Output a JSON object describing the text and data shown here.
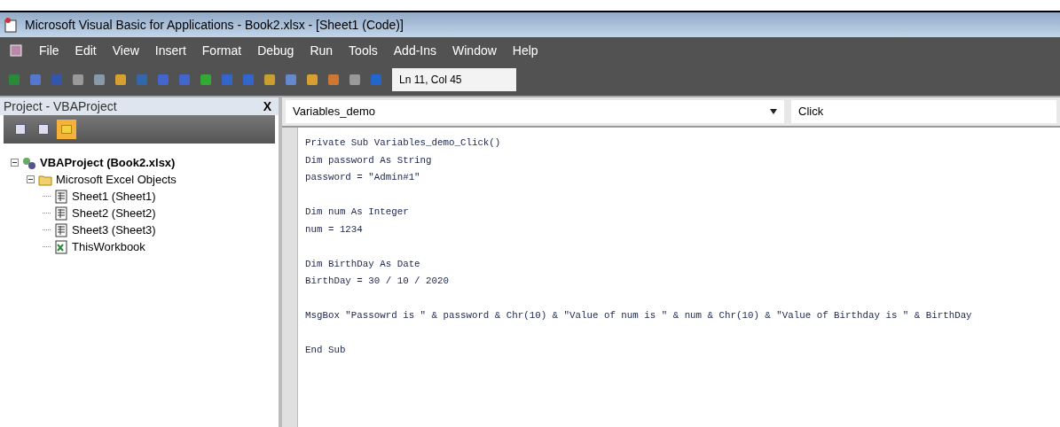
{
  "window": {
    "title": "Microsoft Visual Basic for Applications - Book2.xlsx - [Sheet1 (Code)]"
  },
  "menu": [
    "File",
    "Edit",
    "View",
    "Insert",
    "Format",
    "Debug",
    "Run",
    "Tools",
    "Add-Ins",
    "Window",
    "Help"
  ],
  "toolbar": {
    "position": "Ln 11, Col 45"
  },
  "project_pane": {
    "title": "Project - VBAProject",
    "close": "X",
    "view_buttons": [
      {
        "selected": false
      },
      {
        "selected": false
      },
      {
        "selected": true
      }
    ],
    "tree": [
      {
        "label": "VBAProject (Book2.xlsx)",
        "kind": "project",
        "expanded": true,
        "children": [
          {
            "label": "Microsoft Excel Objects",
            "kind": "folder",
            "expanded": true,
            "children": [
              {
                "label": "Sheet1 (Sheet1)",
                "kind": "sheet"
              },
              {
                "label": "Sheet2 (Sheet2)",
                "kind": "sheet"
              },
              {
                "label": "Sheet3 (Sheet3)",
                "kind": "sheet"
              },
              {
                "label": "ThisWorkbook",
                "kind": "workbook"
              }
            ]
          }
        ]
      }
    ]
  },
  "code_pane": {
    "object": "Variables_demo",
    "procedure": "Click",
    "blocks": [
      [
        "Private Sub Variables_demo_Click()",
        "Dim password As String",
        "password = \"Admin#1\""
      ],
      [
        "Dim num As Integer",
        "num = 1234"
      ],
      [
        "Dim BirthDay As Date",
        "BirthDay = 30 / 10 / 2020"
      ],
      [
        "MsgBox \"Passowrd is \" & password & Chr(10) & \"Value of num is \" & num & Chr(10) & \"Value of Birthday is \" & BirthDay"
      ],
      [
        "End Sub"
      ]
    ]
  }
}
